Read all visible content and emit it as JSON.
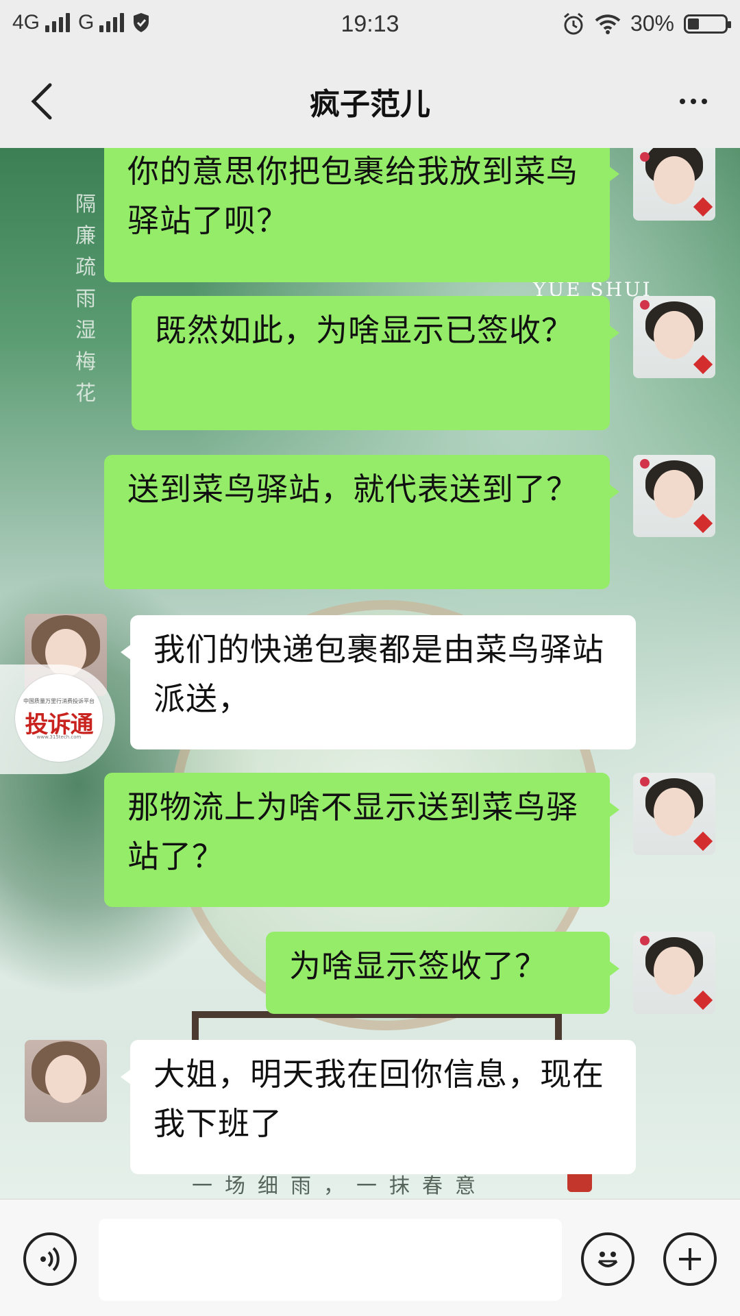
{
  "status_bar": {
    "network1": "4G",
    "network2": "G",
    "time": "19:13",
    "battery_percent": "30%",
    "battery_level": 0.3
  },
  "header": {
    "title": "疯子范儿",
    "back_icon": "chevron-left-icon",
    "more_icon": "more-dots-icon"
  },
  "background_art": {
    "vertical_poem": [
      "隔",
      "廉",
      "疏",
      "雨",
      "湿",
      "梅",
      "花"
    ],
    "latin": "YUE SHUI",
    "bottom_text": "一场细雨，一抹春意"
  },
  "watermark": {
    "small_text": "中国质量万里行消费投诉平台",
    "brand": "投诉通",
    "url": "www.315tech.com"
  },
  "messages": [
    {
      "sender": "me",
      "text": "你的意思你把包裹给我放到菜鸟驿站了呗？"
    },
    {
      "sender": "me",
      "text": "既然如此，为啥显示已签收？"
    },
    {
      "sender": "me",
      "text": "送到菜鸟驿站，就代表送到了？"
    },
    {
      "sender": "them",
      "text": "我们的快递包裹都是由菜鸟驿站派送，"
    },
    {
      "sender": "me",
      "text": "那物流上为啥不显示送到菜鸟驿站了？"
    },
    {
      "sender": "me",
      "text": "为啥显示签收了？"
    },
    {
      "sender": "them",
      "text": "大姐，明天我在回你信息，现在我下班了"
    }
  ],
  "input_bar": {
    "voice_icon": "voice-icon",
    "emoji_icon": "emoji-icon",
    "plus_icon": "plus-icon",
    "input_value": ""
  }
}
